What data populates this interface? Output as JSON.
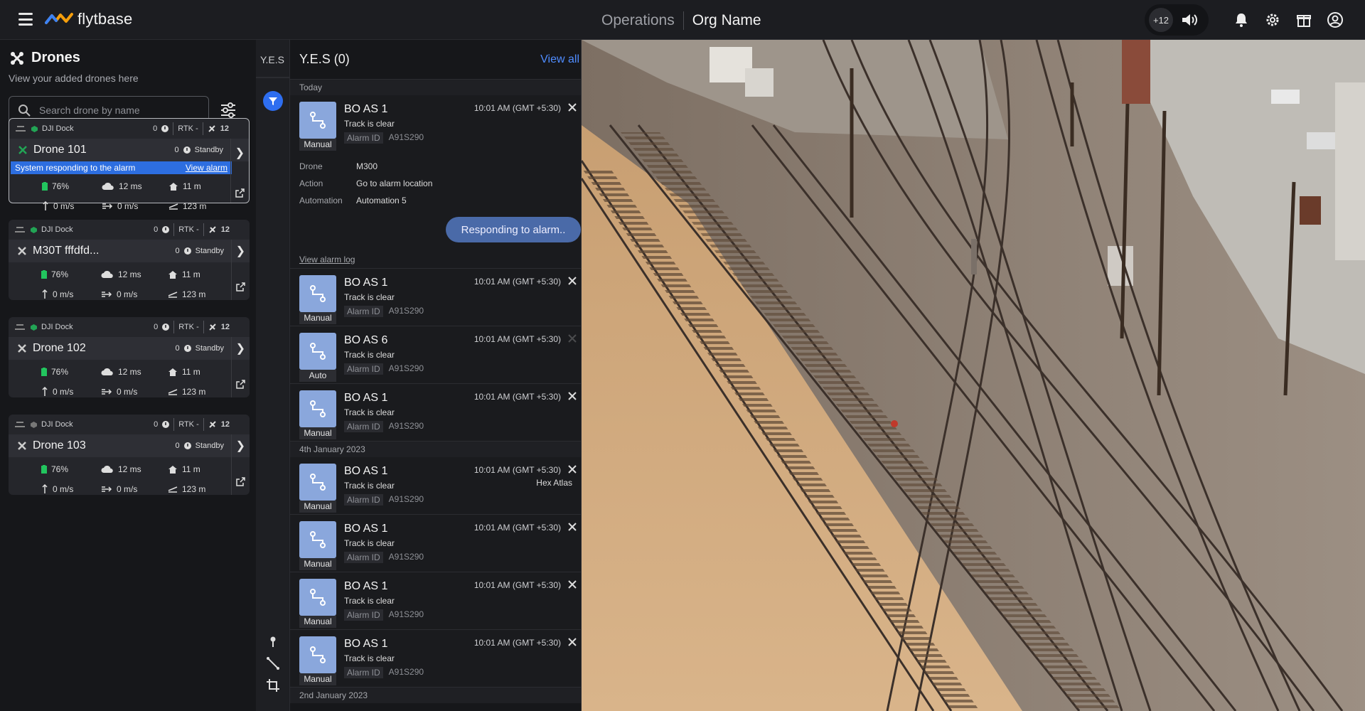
{
  "header": {
    "logo_text": "flytbase",
    "section": "Operations",
    "org": "Org Name",
    "notif_count": "+12",
    "icons": [
      "speaker-icon",
      "bell-icon",
      "gear-icon",
      "gift-icon",
      "account-icon"
    ]
  },
  "sidebar": {
    "title": "Drones",
    "subtitle": "View your added drones here",
    "search_placeholder": "Search drone by name"
  },
  "drones": [
    {
      "dock": "DJI Dock",
      "dock_count": "0",
      "rtk": "RTK -",
      "signal": "12",
      "name": "Drone 101",
      "status_count": "0",
      "status": "Standby",
      "alarm_text": "System responding to the alarm",
      "alarm_link": "View alarm",
      "battery": "76%",
      "weather": "12 ms",
      "home": "11 m",
      "vspeed": "0 m/s",
      "hspeed": "0 m/s",
      "altitude": "123 m"
    },
    {
      "dock": "DJI Dock",
      "dock_count": "0",
      "rtk": "RTK -",
      "signal": "12",
      "name": "M30T fffdfd...",
      "status_count": "0",
      "status": "Standby",
      "battery": "76%",
      "weather": "12 ms",
      "home": "11 m",
      "vspeed": "0 m/s",
      "hspeed": "0 m/s",
      "altitude": "123 m"
    },
    {
      "dock": "DJI Dock",
      "dock_count": "0",
      "rtk": "RTK -",
      "signal": "12",
      "name": "Drone 102",
      "status_count": "0",
      "status": "Standby",
      "battery": "76%",
      "weather": "12 ms",
      "home": "11 m",
      "vspeed": "0 m/s",
      "hspeed": "0 m/s",
      "altitude": "123 m"
    },
    {
      "dock": "DJI Dock",
      "dock_count": "0",
      "rtk": "RTK -",
      "signal": "12",
      "name": "Drone 103",
      "status_count": "0",
      "status": "Standby",
      "battery": "76%",
      "weather": "12 ms",
      "home": "11 m",
      "vspeed": "0 m/s",
      "hspeed": "0 m/s",
      "altitude": "123 m"
    }
  ],
  "narrow": {
    "tab": "Y.E.S"
  },
  "panel": {
    "title": "Y.E.S (0)",
    "view_all": "View all",
    "dates": [
      "Today",
      "4th January 2023",
      "2nd January 2023"
    ],
    "expanded": {
      "title": "BO AS 1",
      "sub": "Track is clear",
      "id_label": "Alarm ID",
      "id": "A91S290",
      "mode": "Manual",
      "time": "10:01 AM (GMT +5:30)",
      "details": [
        {
          "k": "Drone",
          "v": "M300"
        },
        {
          "k": "Action",
          "v": "Go to alarm location"
        },
        {
          "k": "Automation",
          "v": "Automation 5"
        }
      ],
      "button": "Responding to alarm..",
      "log_link": "View alarm log"
    },
    "alarms": [
      {
        "title": "BO AS 1",
        "sub": "Track is clear",
        "id_label": "Alarm ID",
        "id": "A91S290",
        "mode": "Manual",
        "time": "10:01 AM (GMT +5:30)"
      },
      {
        "title": "BO AS 6",
        "sub": "Track is clear",
        "id_label": "Alarm ID",
        "id": "A91S290",
        "mode": "Auto",
        "time": "10:01 AM (GMT +5:30)"
      },
      {
        "title": "BO AS 1",
        "sub": "Track is clear",
        "id_label": "Alarm ID",
        "id": "A91S290",
        "mode": "Manual",
        "time": "10:01 AM (GMT +5:30)"
      },
      {
        "title": "BO AS 1",
        "sub": "Track is clear",
        "id_label": "Alarm ID",
        "id": "A91S290",
        "mode": "Manual",
        "time": "10:01 AM (GMT +5:30)",
        "extra": "Hex Atlas"
      },
      {
        "title": "BO AS 1",
        "sub": "Track is clear",
        "id_label": "Alarm ID",
        "id": "A91S290",
        "mode": "Manual",
        "time": "10:01 AM (GMT +5:30)"
      },
      {
        "title": "BO AS 1",
        "sub": "Track is clear",
        "id_label": "Alarm ID",
        "id": "A91S290",
        "mode": "Manual",
        "time": "10:01 AM (GMT +5:30)"
      },
      {
        "title": "BO AS 1",
        "sub": "Track is clear",
        "id_label": "Alarm ID",
        "id": "A91S290",
        "mode": "Manual",
        "time": "10:01 AM (GMT +5:30)"
      }
    ]
  },
  "colors": {
    "accent": "#2e6ef0",
    "link": "#4f8cff",
    "battery": "#22c55e",
    "dock_green": "#22a455"
  }
}
